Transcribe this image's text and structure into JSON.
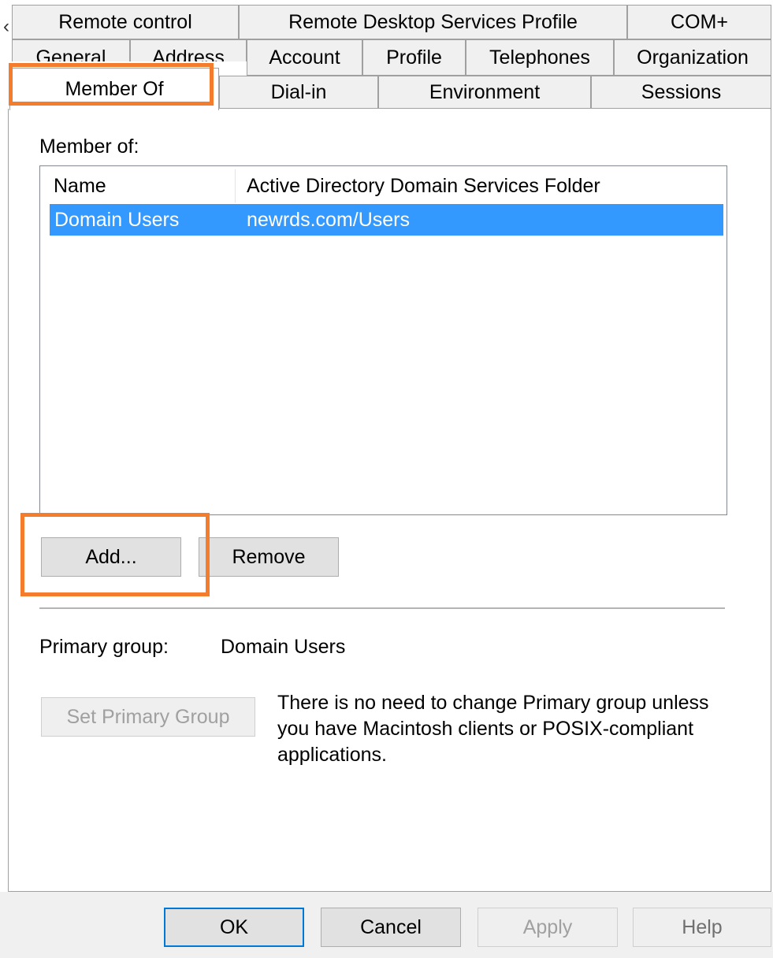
{
  "tabs": {
    "row1": [
      "Remote control",
      "Remote Desktop Services Profile",
      "COM+"
    ],
    "row2": [
      "General",
      "Address",
      "Account",
      "Profile",
      "Telephones",
      "Organization"
    ],
    "row3": [
      "Member Of",
      "Dial-in",
      "Environment",
      "Sessions"
    ],
    "active": "Member Of"
  },
  "member_of": {
    "label": "Member of:",
    "columns": [
      "Name",
      "Active Directory Domain Services Folder"
    ],
    "rows": [
      {
        "name": "Domain Users",
        "folder": "newrds.com/Users",
        "selected": true
      }
    ]
  },
  "buttons": {
    "add": "Add...",
    "remove": "Remove",
    "set_primary_group": "Set Primary Group"
  },
  "primary_group": {
    "label": "Primary group:",
    "value": "Domain Users"
  },
  "info_text": "There is no need to change Primary group unless you have Macintosh clients or POSIX-compliant applications.",
  "footer": {
    "ok": "OK",
    "cancel": "Cancel",
    "apply": "Apply",
    "help": "Help"
  },
  "colors": {
    "selection": "#3399ff",
    "highlight": "#f37c2d",
    "focus_border": "#0078d7"
  }
}
